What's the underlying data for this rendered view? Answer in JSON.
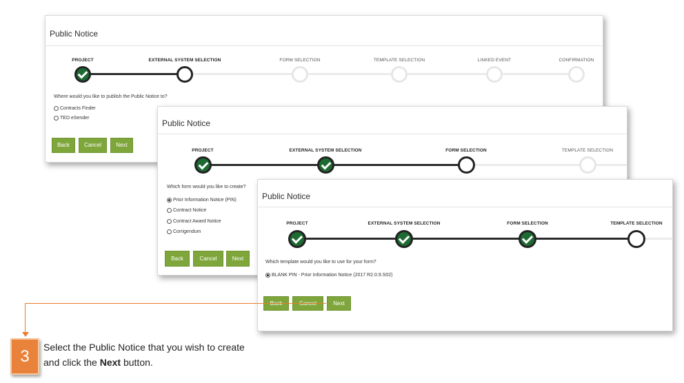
{
  "panel1": {
    "title": "Public Notice",
    "steps": [
      "PROJECT",
      "EXTERNAL SYSTEM SELECTION",
      "FORM SELECTION",
      "TEMPLATE SELECTION",
      "LINKED EVENT",
      "CONFIRMATION"
    ],
    "question": "Where would you like to publish the Public Notice to?",
    "options": [
      "Contracts Finder",
      "TED eSender"
    ],
    "buttons": {
      "back": "Back",
      "cancel": "Cancel",
      "next": "Next"
    }
  },
  "panel2": {
    "title": "Public Notice",
    "steps": [
      "PROJECT",
      "EXTERNAL SYSTEM SELECTION",
      "FORM SELECTION",
      "TEMPLATE SELECTION"
    ],
    "question": "Which form would you like to create?",
    "options": [
      "Prior Information Notice (PIN)",
      "Contract Notice",
      "Contract Award Notice",
      "Corrigendum"
    ],
    "selected": "Prior Information Notice (PIN)",
    "buttons": {
      "back": "Back",
      "cancel": "Cancel",
      "next": "Next"
    }
  },
  "panel3": {
    "title": "Public Notice",
    "steps": [
      "PROJECT",
      "EXTERNAL SYSTEM SELECTION",
      "FORM SELECTION",
      "TEMPLATE SELECTION"
    ],
    "question": "Which template would you like to use for your form?",
    "options": [
      "BLANK PIN - Prior Information Notice (2017 R2.0.9.S02)"
    ],
    "selected": "BLANK PIN - Prior Information Notice (2017 R2.0.9.S02)",
    "buttons": {
      "back": "Back",
      "cancel": "Cancel",
      "next": "Next"
    }
  },
  "callout": {
    "number": "3",
    "text_before": "Select the Public Notice that you wish to create",
    "text_line2_before": "and click the ",
    "text_bold": "Next",
    "text_after": " button."
  },
  "colors": {
    "button": "#7ea63b",
    "done_step": "#1d6a32",
    "callout": "#e87c2b"
  }
}
